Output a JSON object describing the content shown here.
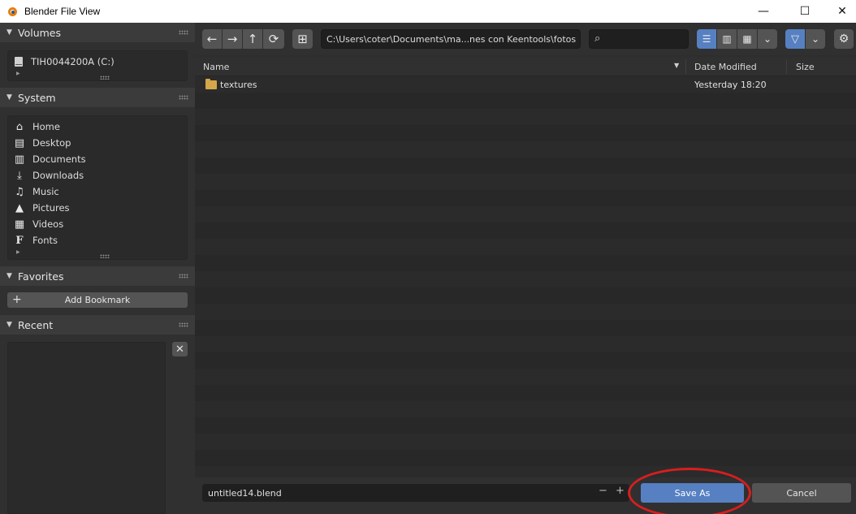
{
  "window": {
    "title": "Blender File View",
    "minimize_glyph": "—",
    "maximize_glyph": "☐",
    "close_glyph": "✕",
    "app_icon": "blender-logo-icon"
  },
  "sidebar": {
    "volumes": {
      "header": "Volumes",
      "items": [
        {
          "label": "TIH0044200A (C:)",
          "icon": "drive-icon"
        }
      ]
    },
    "system": {
      "header": "System",
      "items": [
        {
          "label": "Home",
          "icon": "home-icon",
          "glyph": "⌂"
        },
        {
          "label": "Desktop",
          "icon": "desktop-icon",
          "glyph": "▤"
        },
        {
          "label": "Documents",
          "icon": "documents-icon",
          "glyph": "▥"
        },
        {
          "label": "Downloads",
          "icon": "downloads-icon",
          "glyph": "⤓"
        },
        {
          "label": "Music",
          "icon": "music-icon",
          "glyph": "♫"
        },
        {
          "label": "Pictures",
          "icon": "pictures-icon",
          "glyph": "▲"
        },
        {
          "label": "Videos",
          "icon": "videos-icon",
          "glyph": "▦"
        },
        {
          "label": "Fonts",
          "icon": "fonts-icon",
          "glyph": "F"
        }
      ]
    },
    "favorites": {
      "header": "Favorites",
      "add_bookmark_label": "Add Bookmark",
      "add_glyph": "+"
    },
    "recent": {
      "header": "Recent",
      "clear_glyph": "✕"
    }
  },
  "toolbar": {
    "back_glyph": "←",
    "forward_glyph": "→",
    "parent_glyph": "↑",
    "refresh_glyph": "⟳",
    "new_folder_glyph": "⊞",
    "path": "C:\\Users\\coter\\Documents\\ma...nes con Keentools\\fotos",
    "search_placeholder": "",
    "search_glyph": "⌕",
    "view_vertical_list_glyph": "☰",
    "view_horizontal_list_glyph": "▥",
    "view_thumbnails_glyph": "▦",
    "view_dropdown_glyph": "⌄",
    "filter_glyph": "▽",
    "filter_dropdown_glyph": "⌄",
    "settings_glyph": "⚙"
  },
  "columns": {
    "name": "Name",
    "date": "Date Modified",
    "size": "Size",
    "sort_glyph": "▼"
  },
  "files": [
    {
      "name": "textures",
      "date": "Yesterday 18:20",
      "size": "",
      "type": "folder"
    }
  ],
  "footer": {
    "filename": "untitled14.blend",
    "decrement_glyph": "−",
    "increment_glyph": "+",
    "save_label": "Save As",
    "cancel_label": "Cancel"
  },
  "colors": {
    "accent": "#5680c2",
    "annotation": "#d81e1e",
    "folder": "#d4a74a",
    "blender_orange": "#e87d0d"
  }
}
